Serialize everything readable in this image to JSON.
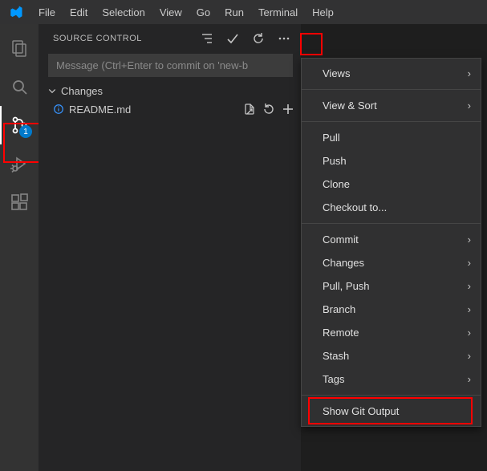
{
  "menubar": {
    "items": [
      "File",
      "Edit",
      "Selection",
      "View",
      "Go",
      "Run",
      "Terminal",
      "Help"
    ]
  },
  "activity": {
    "scm_badge": "1"
  },
  "source_control": {
    "title": "SOURCE CONTROL",
    "message_placeholder": "Message (Ctrl+Enter to commit on 'new-b",
    "changes_label": "Changes",
    "file": {
      "name": "README.md"
    }
  },
  "context_menu": {
    "views": "Views",
    "view_sort": "View & Sort",
    "pull": "Pull",
    "push": "Push",
    "clone": "Clone",
    "checkout": "Checkout to...",
    "commit": "Commit",
    "changes": "Changes",
    "pull_push": "Pull, Push",
    "branch": "Branch",
    "remote": "Remote",
    "stash": "Stash",
    "tags": "Tags",
    "show_git_output": "Show Git Output"
  }
}
